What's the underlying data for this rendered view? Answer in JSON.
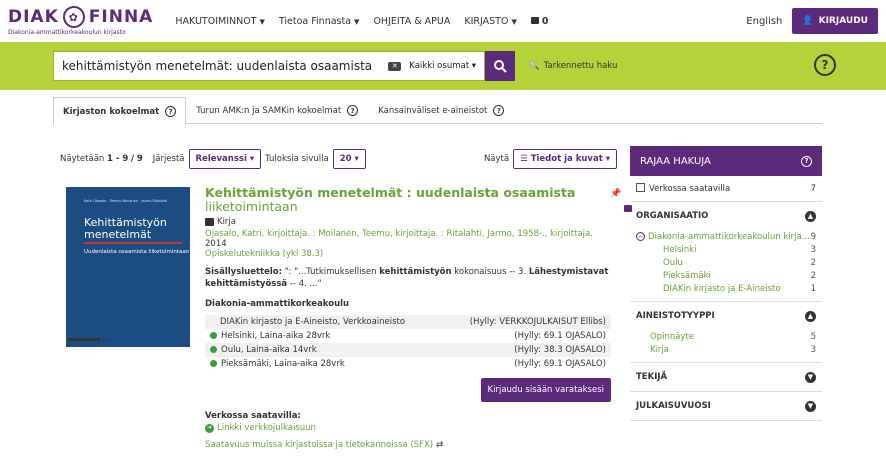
{
  "header": {
    "logo_main_left": "DIAK",
    "logo_main_right": "FINNA",
    "logo_sub": "Diakonia-ammattikorkeakoulun kirjasto",
    "nav": [
      {
        "label": "HAKUTOIMINNOT",
        "dropdown": true
      },
      {
        "label": "Tietoa Finnasta",
        "dropdown": true
      },
      {
        "label": "OHJEITA & APUA",
        "dropdown": false
      },
      {
        "label": "KIRJASTO",
        "dropdown": true
      }
    ],
    "basket_count": "0",
    "language": "English",
    "login": "KIRJAUDU"
  },
  "search": {
    "query": "kehittämistyön menetelmät: uudenlaista osaamista",
    "scope": "Kaikki osumat",
    "advanced": "Tarkennettu haku"
  },
  "tabs": [
    {
      "label": "Kirjaston kokoelmat",
      "active": true
    },
    {
      "label": "Turun AMK:n ja SAMKin kokoelmat",
      "active": false
    },
    {
      "label": "Kansainväliset e-aineistot",
      "active": false
    }
  ],
  "controls": {
    "showing_prefix": "Näytetään",
    "showing_range": "1 - 9",
    "showing_sep": "/",
    "showing_total": "9",
    "sort_label": "Järjestä",
    "sort_value": "Relevanssi",
    "per_page_label": "Tuloksia sivulla",
    "per_page_value": "20",
    "view_label": "Näytä",
    "view_value": "Tiedot ja kuvat"
  },
  "cover": {
    "authors": "Katri Ojasalo · Teemu Moilanen · Jarmo Ritalahti",
    "title": "Kehittämistyön menetelmät",
    "subtitle": "Uudenlaista osaamista liiketoimintaan",
    "publisher": "pro"
  },
  "record": {
    "title_bold": "Kehittämistyön menetelmät",
    "title_colon": ":",
    "title_bold2": "uudenlaista osaamista",
    "title_rest": "liiketoimintaan",
    "format": "Kirja",
    "authors": "Ojasalo, Katri, kirjoittaja. : Moilanen, Teemu, kirjoittaja. : Ritalahti, Jarmo, 1958-., kirjoittaja.",
    "year": "2014",
    "classification": "Opiskelutekniikka (ykl 38.3)",
    "toc_label": "Sisällysluettelo:",
    "toc_a": "\": \"...Tutkimuksellisen",
    "toc_b": "kehittämistyön",
    "toc_c": "kokonaisuus -- 3.",
    "toc_d": "Lähestymistavat kehittämistyössä",
    "toc_e": "-- 4. ...\"",
    "library": "Diakonia-ammattikorkeakoulu",
    "holdings": [
      {
        "loc": "DIAKin kirjasto ja E-Aineisto, Verkkoaineisto",
        "shelf": "(Hylly: VERKKOJULKAISUT Ellibs)",
        "avail": false
      },
      {
        "loc": "Helsinki, Laina-aika 28vrk",
        "shelf": "(Hylly: 69.1 OJASALO)",
        "avail": true
      },
      {
        "loc": "Oulu, Laina-aika 14vrk",
        "shelf": "(Hylly: 38.3 OJASALO)",
        "avail": true
      },
      {
        "loc": "Pieksämäki, Laina-aika 28vrk",
        "shelf": "(Hylly: 69.1 OJASALO)",
        "avail": true
      }
    ],
    "reserve": "Kirjaudu sisään varataksesi",
    "online_label": "Verkossa saatavilla:",
    "online_link": "Linkki verkkojulkaisuun",
    "sfx": "Saatavuus muissa kirjastoissa ja tietokannoissa (SFX)"
  },
  "facets": {
    "title": "RAJAA HAKUJA",
    "online": {
      "label": "Verkossa saatavilla",
      "count": "7"
    },
    "sections": [
      {
        "title": "ORGANISAATIO",
        "items": [
          {
            "label": "Diakonia-ammattikorkeakoulun kirja...",
            "count": "9",
            "top": true
          },
          {
            "label": "Helsinki",
            "count": "3"
          },
          {
            "label": "Oulu",
            "count": "2"
          },
          {
            "label": "Pieksämäki",
            "count": "2"
          },
          {
            "label": "DIAKin kirjasto ja E-Aineisto",
            "count": "1"
          }
        ]
      },
      {
        "title": "AINEISTOTYYPPI",
        "items": [
          {
            "label": "Opinnäyte",
            "count": "5"
          },
          {
            "label": "Kirja",
            "count": "3"
          }
        ]
      },
      {
        "title": "TEKIJÄ",
        "items": []
      },
      {
        "title": "JULKAISUVUOSI",
        "items": []
      }
    ]
  }
}
